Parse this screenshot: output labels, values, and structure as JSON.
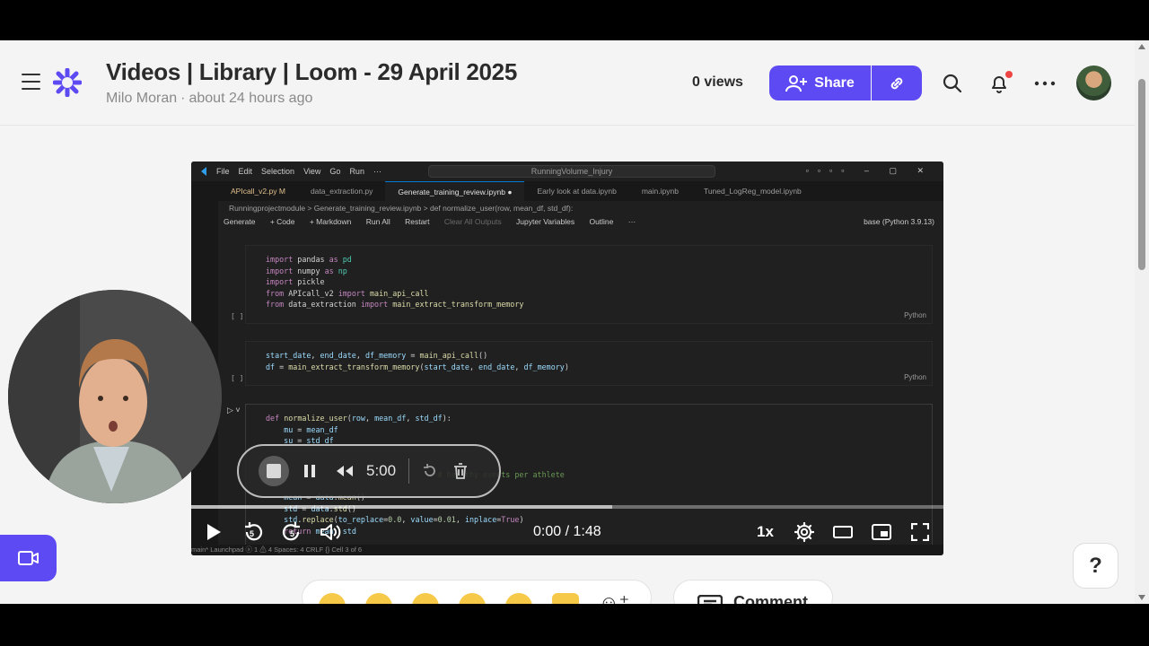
{
  "header": {
    "title": "Videos | Library | Loom - 29 April 2025",
    "author": "Milo Moran",
    "meta_sep": "·",
    "time_ago": "about 24 hours ago",
    "views": "0 views",
    "share_label": "Share"
  },
  "vscode": {
    "menu": [
      "File",
      "Edit",
      "Selection",
      "View",
      "Go",
      "Run",
      "···"
    ],
    "search": "RunningVolume_Injury",
    "tabs": [
      {
        "label": "APIcall_v2.py M",
        "state": "modified"
      },
      {
        "label": "data_extraction.py",
        "state": "normal"
      },
      {
        "label": "Generate_training_review.ipynb ●",
        "state": "active"
      },
      {
        "label": "Early look at data.ipynb",
        "state": "normal"
      },
      {
        "label": "main.ipynb",
        "state": "normal"
      },
      {
        "label": "Tuned_LogReg_model.ipynb",
        "state": "normal"
      }
    ],
    "breadcrumb": "Runningprojectmodule  >  Generate_training_review.ipynb  >  def normalize_user(row, mean_df, std_df):",
    "toolbar": [
      "Generate",
      "+ Code",
      "+ Markdown",
      "Run All",
      "Restart",
      "Clear All Outputs",
      "Jupyter Variables",
      "Outline",
      "···"
    ],
    "kernel": "base (Python 3.9.13)",
    "cell_lang": "Python",
    "cell_bracket": "[ ]",
    "status": "main*   Launchpad   ⓧ 1 ⚠ 4                                                                      Spaces: 4   CRLF   {}   Cell 3 of 6"
  },
  "recorder": {
    "time": "5:00"
  },
  "player": {
    "current": "0:00",
    "separator": "/",
    "duration": "1:48",
    "speed": "1x",
    "progress_fraction": 0.56,
    "skip_back": "5",
    "skip_forward": "5"
  },
  "misc": {
    "help": "?",
    "comment": "Comment"
  },
  "colors": {
    "brand": "#5e4af2",
    "notification": "#ef4444"
  },
  "icons": [
    "hamburger-icon",
    "loom-logo-icon",
    "add-person-icon",
    "link-icon",
    "search-icon",
    "bell-icon",
    "more-icon",
    "play-icon",
    "rewind-icon",
    "forward-icon",
    "volume-icon",
    "settings-icon",
    "theater-icon",
    "pip-icon",
    "fullscreen-icon",
    "camera-icon"
  ]
}
